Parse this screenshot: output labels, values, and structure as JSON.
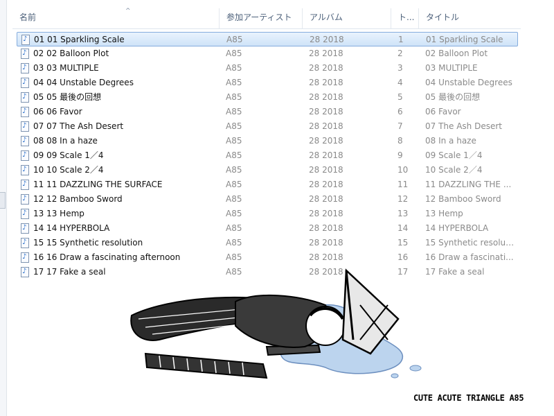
{
  "columns": {
    "name": "名前",
    "artist": "参加アーティスト",
    "album": "アルバム",
    "track": "ト...",
    "title": "タイトル"
  },
  "sort_indicator": "^",
  "rows": [
    {
      "name": "01 01 Sparkling Scale",
      "artist": "A85",
      "album": "28 2018",
      "track": "1",
      "title": "01 Sparkling Scale"
    },
    {
      "name": "02 02 Balloon Plot",
      "artist": "A85",
      "album": "28 2018",
      "track": "2",
      "title": "02 Balloon Plot"
    },
    {
      "name": "03 03 MULTIPLE",
      "artist": "A85",
      "album": "28 2018",
      "track": "3",
      "title": "03 MULTIPLE"
    },
    {
      "name": "04 04 Unstable Degrees",
      "artist": "A85",
      "album": "28 2018",
      "track": "4",
      "title": "04 Unstable Degrees"
    },
    {
      "name": "05 05 最後の回想",
      "artist": "A85",
      "album": "28 2018",
      "track": "5",
      "title": "05 最後の回想"
    },
    {
      "name": "06 06 Favor",
      "artist": "A85",
      "album": "28 2018",
      "track": "6",
      "title": "06 Favor"
    },
    {
      "name": "07 07 The Ash Desert",
      "artist": "A85",
      "album": "28 2018",
      "track": "7",
      "title": "07 The Ash Desert"
    },
    {
      "name": "08 08 In a haze",
      "artist": "A85",
      "album": "28 2018",
      "track": "8",
      "title": "08 In a haze"
    },
    {
      "name": "09 09 Scale 1／4",
      "artist": "A85",
      "album": "28 2018",
      "track": "9",
      "title": "09 Scale 1／4"
    },
    {
      "name": "10 10 Scale 2／4",
      "artist": "A85",
      "album": "28 2018",
      "track": "10",
      "title": "10 Scale 2／4"
    },
    {
      "name": "11 11 DAZZLING THE SURFACE",
      "artist": "A85",
      "album": "28 2018",
      "track": "11",
      "title": "11 DAZZLING THE ..."
    },
    {
      "name": "12 12 Bamboo Sword",
      "artist": "A85",
      "album": "28 2018",
      "track": "12",
      "title": "12 Bamboo Sword"
    },
    {
      "name": "13 13 Hemp",
      "artist": "A85",
      "album": "28 2018",
      "track": "13",
      "title": "13 Hemp"
    },
    {
      "name": "14 14 HYPERBOLA",
      "artist": "A85",
      "album": "28 2018",
      "track": "14",
      "title": "14 HYPERBOLA"
    },
    {
      "name": "15 15 Synthetic resolution",
      "artist": "A85",
      "album": "28 2018",
      "track": "15",
      "title": "15 Synthetic resolut..."
    },
    {
      "name": "16 16 Draw a fascinating afternoon",
      "artist": "A85",
      "album": "28 2018",
      "track": "16",
      "title": "16 Draw a fascinati..."
    },
    {
      "name": "17 17 Fake a seal",
      "artist": "A85",
      "album": "28 2018",
      "track": "17",
      "title": "17 Fake a seal"
    }
  ],
  "selected_index": 0,
  "signature": "CUTE ACUTE TRIANGLE  A85",
  "colors": {
    "selection_fill": "#cfe3f8",
    "selection_border": "#84acdd",
    "header_text": "#4c607a",
    "secondary_text": "#8a8a8a",
    "puddle": "#bcd4ee"
  },
  "icons": {
    "row": "music-file-icon",
    "header": "sort-ascending-icon"
  }
}
